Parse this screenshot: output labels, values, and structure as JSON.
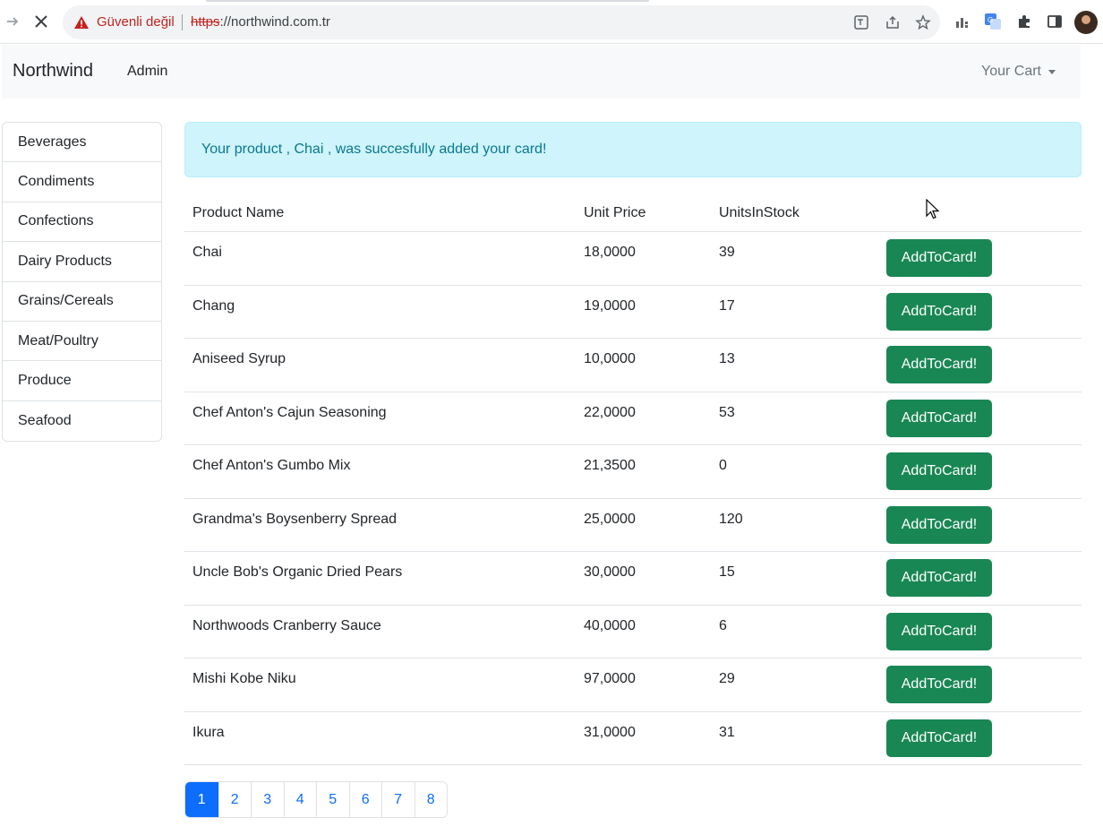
{
  "browser": {
    "security_label": "Güvenli değil",
    "url_scheme": "https",
    "url_rest": "://northwind.com.tr"
  },
  "navbar": {
    "brand": "Northwind",
    "admin_link": "Admin",
    "cart_label": "Your Cart"
  },
  "sidebar": {
    "items": [
      {
        "label": "Beverages"
      },
      {
        "label": "Condiments"
      },
      {
        "label": "Confections"
      },
      {
        "label": "Dairy Products"
      },
      {
        "label": "Grains/Cereals"
      },
      {
        "label": "Meat/Poultry"
      },
      {
        "label": "Produce"
      },
      {
        "label": "Seafood"
      }
    ]
  },
  "alert": {
    "message": "Your product , Chai , was succesfully added your card!"
  },
  "table": {
    "headers": {
      "name": "Product Name",
      "price": "Unit Price",
      "stock": "UnitsInStock"
    },
    "button_label": "AddToCard!",
    "rows": [
      {
        "name": "Chai",
        "price": "18,0000",
        "stock": "39"
      },
      {
        "name": "Chang",
        "price": "19,0000",
        "stock": "17"
      },
      {
        "name": "Aniseed Syrup",
        "price": "10,0000",
        "stock": "13"
      },
      {
        "name": "Chef Anton's Cajun Seasoning",
        "price": "22,0000",
        "stock": "53"
      },
      {
        "name": "Chef Anton's Gumbo Mix",
        "price": "21,3500",
        "stock": "0"
      },
      {
        "name": "Grandma's Boysenberry Spread",
        "price": "25,0000",
        "stock": "120"
      },
      {
        "name": "Uncle Bob's Organic Dried Pears",
        "price": "30,0000",
        "stock": "15"
      },
      {
        "name": "Northwoods Cranberry Sauce",
        "price": "40,0000",
        "stock": "6"
      },
      {
        "name": "Mishi Kobe Niku",
        "price": "97,0000",
        "stock": "29"
      },
      {
        "name": "Ikura",
        "price": "31,0000",
        "stock": "31"
      }
    ]
  },
  "pagination": {
    "pages": [
      "1",
      "2",
      "3",
      "4",
      "5",
      "6",
      "7",
      "8"
    ],
    "active": "1"
  },
  "colors": {
    "success": "#198754",
    "primary": "#0d6efd",
    "alert_bg": "#cff4fc",
    "alert_text": "#087990"
  }
}
